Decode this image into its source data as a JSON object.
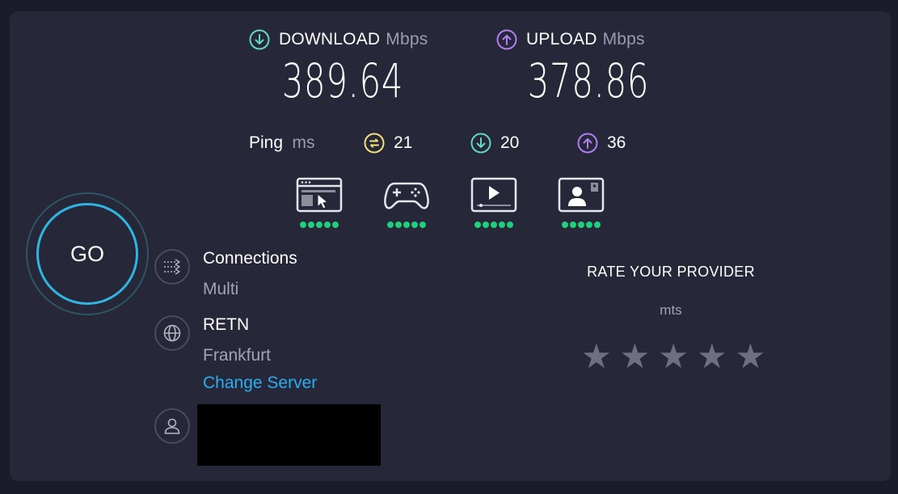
{
  "download": {
    "label": "DOWNLOAD",
    "unit": "Mbps",
    "value": "389.64",
    "icon": "arrow-down-circle-icon",
    "color": "#63d7c6"
  },
  "upload": {
    "label": "UPLOAD",
    "unit": "Mbps",
    "value": "378.86",
    "icon": "arrow-up-circle-icon",
    "color": "#b27df0"
  },
  "ping": {
    "label": "Ping",
    "unit": "ms",
    "idle": {
      "value": "21",
      "icon": "latency-icon",
      "color": "#f3e07a"
    },
    "download": {
      "value": "20",
      "icon": "arrow-down-circle-icon",
      "color": "#63d7c6"
    },
    "upload": {
      "value": "36",
      "icon": "arrow-up-circle-icon",
      "color": "#b27df0"
    }
  },
  "experience": [
    {
      "name": "web-browsing",
      "icon": "browser-cursor-icon",
      "rating": 5
    },
    {
      "name": "gaming",
      "icon": "gamepad-icon",
      "rating": 5
    },
    {
      "name": "video-streaming",
      "icon": "video-play-icon",
      "rating": 5
    },
    {
      "name": "video-chat",
      "icon": "video-call-icon",
      "rating": 5
    }
  ],
  "go": {
    "label": "GO"
  },
  "connections": {
    "title": "Connections",
    "value": "Multi",
    "icon": "connections-icon"
  },
  "server": {
    "title": "RETN",
    "location": "Frankfurt",
    "change_label": "Change Server",
    "icon": "globe-icon"
  },
  "user": {
    "icon": "user-icon",
    "redacted": true
  },
  "rate": {
    "title": "RATE YOUR PROVIDER",
    "isp": "mts",
    "stars": 5,
    "rating": 0
  },
  "colors": {
    "accent_blue": "#2aaef0",
    "good_green": "#1fcf7c",
    "panel": "#262739",
    "background": "#1b1b29"
  }
}
